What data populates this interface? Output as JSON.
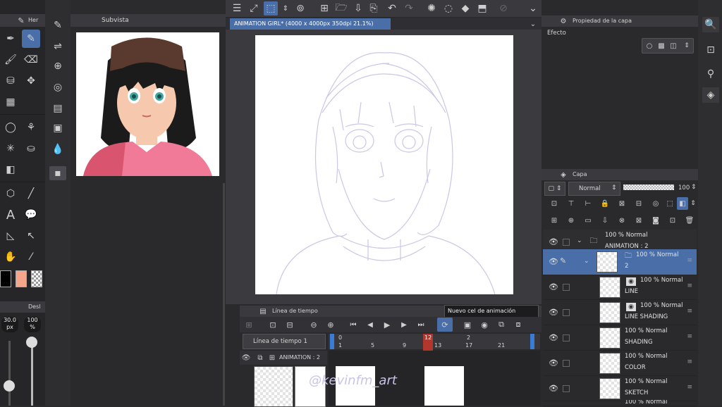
{
  "subview": {
    "tab": "Subvista"
  },
  "tool_tab": {
    "label": "Her"
  },
  "brush": {
    "tab": "Desl",
    "size": "30.0",
    "size_unit": "px",
    "opacity": "100",
    "opacity_unit": "%"
  },
  "canvas": {
    "title": "ANIMATION GIRL* (4000 x 4000px 350dpi 21.1%)"
  },
  "layer_property": {
    "title": "Propiedad de la capa",
    "effect_label": "Efecto"
  },
  "layer_panel": {
    "title": "Capa",
    "blend_mode": "Normal",
    "opacity": "100",
    "layers": [
      {
        "pct": "100 %",
        "mode": "Normal",
        "name": "ANIMATION : 2",
        "type": "folder"
      },
      {
        "pct": "100 %",
        "mode": "Normal",
        "name": "2",
        "type": "folder",
        "selected": true
      },
      {
        "pct": "100 %",
        "mode": "Normal",
        "name": "LINE",
        "type": "vector"
      },
      {
        "pct": "100 %",
        "mode": "Normal",
        "name": "LINE SHADING",
        "type": "vector"
      },
      {
        "pct": "100 %",
        "mode": "Normal",
        "name": "SHADING",
        "type": "raster"
      },
      {
        "pct": "100 %",
        "mode": "Normal",
        "name": "COLOR",
        "type": "raster"
      },
      {
        "pct": "100 %",
        "mode": "Normal",
        "name": "SKETCH",
        "type": "raster"
      },
      {
        "pct": "100 %",
        "mode": "Normal",
        "name": "",
        "type": "folder"
      }
    ]
  },
  "timeline": {
    "tab": "Línea de tiempo",
    "selector": "Línea de tiempo 1",
    "tooltip": "Nuevo cel de animación",
    "track_name": "ANIMATION : 2",
    "ticks": [
      "0",
      "1",
      "5",
      "9",
      "12",
      "13",
      "2",
      "17",
      "21"
    ],
    "current_frame": 12
  },
  "watermark": "@kevinfm_art",
  "colors": {
    "accent": "#4a6fa8",
    "main": "#000000",
    "sub": "#f4a58a",
    "playhead": "#c0392b",
    "marker": "#3a7bd5"
  },
  "icons": [
    "pen-icon",
    "brush-icon",
    "eraser-icon",
    "fill-icon",
    "lasso-icon",
    "text-icon",
    "hand-icon",
    "eyedropper-icon",
    "eye-icon",
    "play-icon",
    "undo-icon",
    "redo-icon"
  ]
}
